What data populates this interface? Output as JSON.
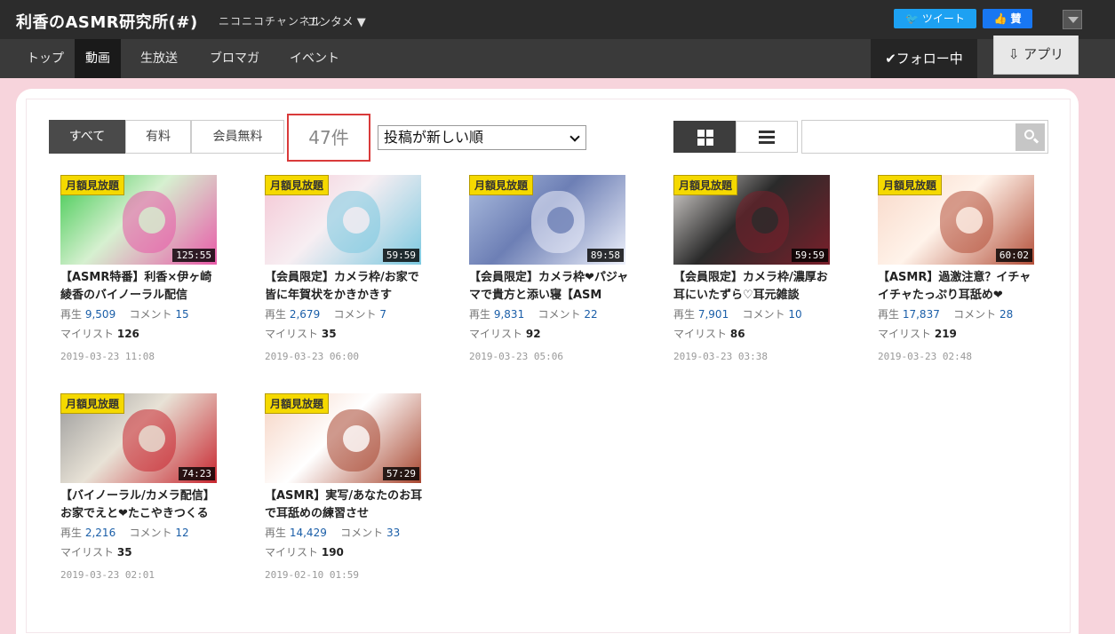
{
  "header": {
    "channel_title": "利香のASMR研究所(#)",
    "brand": "ニコニコチャンネル",
    "category": "エンタメ ▼",
    "tweet_label": "ツイート",
    "like_label": "👍 賛"
  },
  "nav": {
    "items": [
      {
        "label": "トップ"
      },
      {
        "label": "動画"
      },
      {
        "label": "生放送"
      },
      {
        "label": "ブロマガ"
      },
      {
        "label": "イベント"
      }
    ],
    "follow_label": "✔フォロー中",
    "app_label": "アプリ"
  },
  "filters": {
    "tabs": [
      {
        "label": "すべて"
      },
      {
        "label": "有料"
      },
      {
        "label": "会員無料"
      }
    ],
    "count": "47件",
    "sort_selected": "投稿が新しい順",
    "search_placeholder": ""
  },
  "videos": [
    {
      "badge": "月額見放題",
      "duration": "125:55",
      "title": "【ASMR特番】利香×伊ヶ崎綾香のバイノーラル配信",
      "plays": "9,509",
      "comments": "15",
      "mylist": "126",
      "date": "2019-03-23 11:08",
      "thumb_colors": [
        "#3ec94e",
        "#e85aa8",
        "#d6f0d0"
      ]
    },
    {
      "badge": "月額見放題",
      "duration": "59:59",
      "title": "【会員限定】カメラ枠/お家で皆に年賀状をかきかきす",
      "plays": "2,679",
      "comments": "7",
      "mylist": "35",
      "date": "2019-03-23 06:00",
      "thumb_colors": [
        "#f4c6d4",
        "#7cc9e0",
        "#f7eef2"
      ]
    },
    {
      "badge": "月額見放題",
      "duration": "89:58",
      "title": "【会員限定】カメラ枠❤パジャマで貴方と添い寝【ASM",
      "plays": "9,831",
      "comments": "22",
      "mylist": "92",
      "date": "2019-03-23 05:06",
      "thumb_colors": [
        "#aebfe0",
        "#eef1fb",
        "#6d7fb5"
      ]
    },
    {
      "badge": "月額見放題",
      "duration": "59:59",
      "title": "【会員限定】カメラ枠/濃厚お耳にいたずら♡耳元雑談",
      "plays": "7,901",
      "comments": "10",
      "mylist": "86",
      "date": "2019-03-23 03:38",
      "thumb_colors": [
        "#ddd9d6",
        "#7a1f2a",
        "#2a2a2a"
      ]
    },
    {
      "badge": "月額見放題",
      "duration": "60:02",
      "title": "【ASMR】過激注意？イチャイチャたっぷり耳舐め❤",
      "plays": "17,837",
      "comments": "28",
      "mylist": "219",
      "date": "2019-03-23 02:48",
      "thumb_colors": [
        "#f8d8c8",
        "#b4503a",
        "#fff3ea"
      ]
    },
    {
      "badge": "月額見放題",
      "duration": "74:23",
      "title": "【バイノーラル/カメラ配信】お家でえと❤たこやきつくる",
      "plays": "2,216",
      "comments": "12",
      "mylist": "35",
      "date": "2019-03-23 02:01",
      "thumb_colors": [
        "#9a9a9a",
        "#c8262f",
        "#e8e2d6"
      ]
    },
    {
      "badge": "月額見放題",
      "duration": "57:29",
      "title": "【ASMR】実写/あなたのお耳で耳舐めの練習させ",
      "plays": "14,429",
      "comments": "33",
      "mylist": "190",
      "date": "2019-02-10 01:59",
      "thumb_colors": [
        "#f6d3c2",
        "#a8462f",
        "#ffffff"
      ]
    }
  ],
  "labels": {
    "plays": "再生",
    "comments": "コメント",
    "mylist": "マイリスト"
  }
}
